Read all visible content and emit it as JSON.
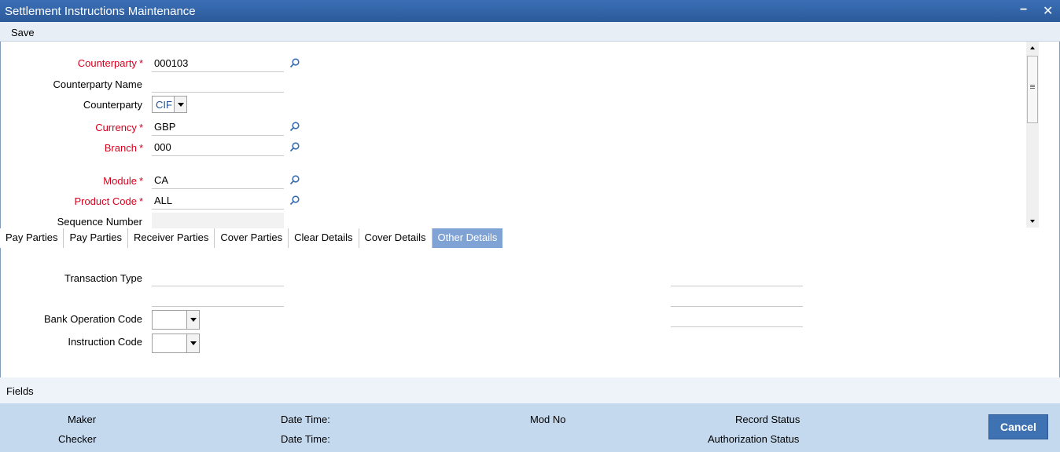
{
  "window": {
    "title": "Settlement Instructions Maintenance",
    "minimize": "−",
    "close": "✕"
  },
  "toolbar": {
    "save_label": "Save"
  },
  "form": {
    "counterparty_label": "Counterparty",
    "counterparty_value": "000103",
    "counterparty_name_label": "Counterparty Name",
    "counterparty_name_value": "",
    "counterparty_type_label": "Counterparty",
    "counterparty_type_value": "CIF",
    "currency_label": "Currency",
    "currency_value": "GBP",
    "branch_label": "Branch",
    "branch_value": "000",
    "module_label": "Module",
    "module_value": "CA",
    "product_code_label": "Product Code",
    "product_code_value": "ALL",
    "sequence_number_label": "Sequence Number",
    "required_marker": "*"
  },
  "tabs": [
    {
      "label": "Pay Parties"
    },
    {
      "label": "Pay Parties"
    },
    {
      "label": "Receiver Parties"
    },
    {
      "label": "Cover Parties"
    },
    {
      "label": "Clear Details"
    },
    {
      "label": "Cover Details"
    },
    {
      "label": "Other Details"
    }
  ],
  "other_details": {
    "transaction_type_label": "Transaction Type",
    "bank_operation_code_label": "Bank Operation Code",
    "instruction_code_label": "Instruction Code"
  },
  "fields_bar": {
    "label": "Fields"
  },
  "audit": {
    "maker_label": "Maker",
    "checker_label": "Checker",
    "date_time_label_1": "Date Time:",
    "date_time_label_2": "Date Time:",
    "mod_no_label": "Mod No",
    "record_status_label": "Record Status",
    "authorization_status_label": "Authorization Status"
  },
  "buttons": {
    "cancel_label": "Cancel"
  },
  "colors": {
    "title_bar": "#2c5a9a",
    "required": "#d6001c",
    "active_tab": "#7fa3d4",
    "audit_bg": "#c5d9ee",
    "cancel_bg": "#3e72b2"
  }
}
